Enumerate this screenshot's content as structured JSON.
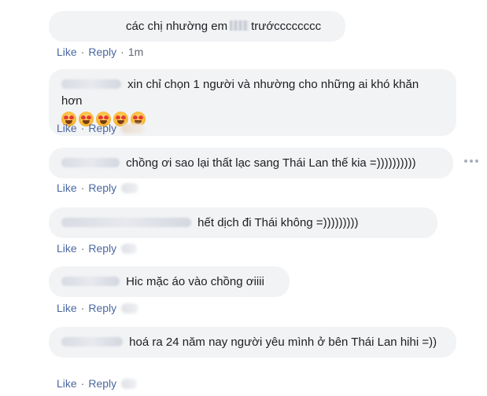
{
  "actions": {
    "like_label": "Like",
    "reply_label": "Reply",
    "separator": "·"
  },
  "comments": [
    {
      "text": "các chị nhường em",
      "text_after": "trướcccccccc",
      "time": "1m"
    },
    {
      "text": "xin chỉ chọn 1 người và nhường cho những ai khó khăn hơn",
      "emoji_count": 5,
      "emoji": "heart-eyes-emoji"
    },
    {
      "text": "chồng ơi sao lại thất lạc sang Thái Lan thế kia =))))))))))"
    },
    {
      "text": "hết dịch đi Thái không =)))))))))"
    },
    {
      "text": "Hic mặc áo vào chồng ơiiii"
    },
    {
      "text": "hoá ra 24 năm nay người yêu mình ở bên Thái Lan hihi =))"
    }
  ]
}
